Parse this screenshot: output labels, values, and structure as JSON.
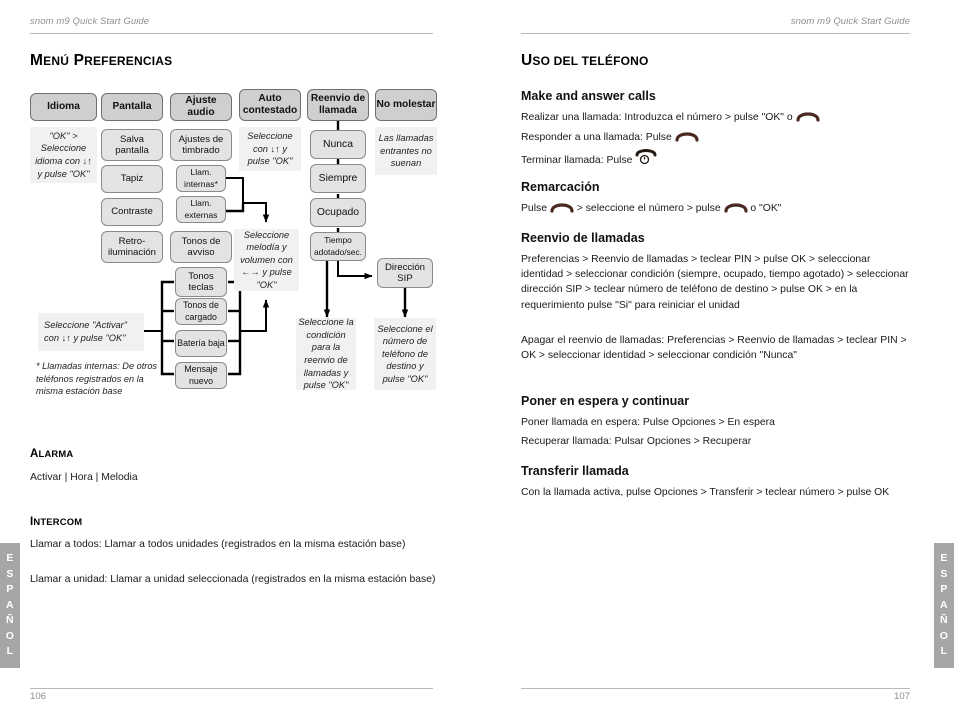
{
  "document": {
    "running_head": "snom m9 Quick Start Guide"
  },
  "left_page": {
    "folio": "106",
    "side_tab": "ESPAÑOL",
    "title_first": "M",
    "title_rest": "ENÚ ",
    "title_second": "P",
    "title_rest2": "REFERENCIAS",
    "title_full": "MENÚ PREFERENCIAS",
    "chart": {
      "columns": [
        {
          "header": "Idioma",
          "note": "\"OK\" > Seleccione idioma con ↓↑ y pulse \"OK\"",
          "items": []
        },
        {
          "header": "Pantalla",
          "items": [
            "Salva pantalla",
            "Tapiz",
            "Contraste",
            "Retro-iluminación"
          ]
        },
        {
          "header": "Ajuste audio",
          "items": [
            "Ajustes de timbrado",
            "Llam. internas*",
            "Llam. externas",
            "Tonos de avviso",
            "Tonos teclas",
            "Tonos de cargado",
            "Batería baja",
            "Mensaje nuevo"
          ]
        },
        {
          "header": "Auto contestado",
          "note": "Seleccione con ↓↑ y pulse \"OK\"",
          "items": []
        },
        {
          "header": "Reenvio de llamada",
          "items": [
            "Nunca",
            "Siempre",
            "Ocupado",
            "Tiempo adotado/sec.",
            "Dirección SIP"
          ]
        },
        {
          "header": "No molestar",
          "note": "Las llamadas entrantes no suenan",
          "items": []
        }
      ],
      "box_idioma": "Idioma",
      "box_pantalla": "Pantalla",
      "box_ajuste_audio": "Ajuste audio",
      "box_auto_contestado": "Auto contestado",
      "box_reenvio_llamada": "Reenvio de llamada",
      "box_no_molestar": "No molestar",
      "box_salva_pantalla": "Salva pantalla",
      "box_tapiz": "Tapiz",
      "box_contraste": "Contraste",
      "box_retroiluminacion": "Retro-iluminación",
      "box_ajustes_timbrado": "Ajustes de timbrado",
      "box_llam_internas": "Llam. internas*",
      "box_llam_externas": "Llam. externas",
      "box_tonos_avviso": "Tonos de avviso",
      "box_tonos_teclas": "Tonos teclas",
      "box_tonos_cargado": "Tonos de cargado",
      "box_bateria_baja": "Batería baja",
      "box_mensaje_nuevo": "Mensaje nuevo",
      "box_nunca": "Nunca",
      "box_siempre": "Siempre",
      "box_ocupado": "Ocupado",
      "box_tiempo": "Tiempo adotado/sec.",
      "box_direccion_sip": "Dirección SIP",
      "note_idioma": "\"OK\" > Seleccione idioma con ↓↑ y pulse \"OK\"",
      "note_auto_contestado": "Seleccione con ↓↑ y pulse \"OK\"",
      "note_no_molestar": "Las llamadas entrantes no suenan",
      "note_melodia": "Seleccione melodía y volumen con ←→ y pulse \"OK\"",
      "note_activar": "Seleccione \"Activar\" con ↓↑  y pulse \"OK\"",
      "note_condicion": "Seleccione la condición para la reenvio de llamadas y pulse \"OK\"",
      "note_numero": "Seleccione el número de teléfono de destino y pulse \"OK\"",
      "footnote": "* Llamadas internas: De otros teléfonos registrados en la misma estación base"
    },
    "sections": [
      {
        "heading_cap": "A",
        "heading_rest": "LARMA",
        "heading": "ALARMA",
        "body": "Activar | Hora | Melodia"
      },
      {
        "heading_cap": "I",
        "heading_rest": "NTERCOM",
        "heading": "INTERCOM",
        "body_1": "Llamar a todos:  Llamar a todos unidades (registrados en la misma estación base)",
        "body_2": "Llamar a unidad:  Llamar a unidad seleccionada (registrados en la misma estación base)"
      }
    ]
  },
  "right_page": {
    "folio": "107",
    "side_tab": "ESPAÑOL",
    "title_cap": "U",
    "title_rest": "SO DEL TELÉFONO",
    "title_full": "USO DEL TELÉFONO",
    "sections": [
      {
        "heading": "Make and answer calls",
        "lines": [
          {
            "pre": "Realizar una llamada: Introduzca el número > pulse \"OK\" o ",
            "icon": "handset-icon",
            "post": ""
          },
          {
            "pre": "Responder a una llamada: Pulse ",
            "icon": "handset-icon",
            "post": ""
          },
          {
            "pre": "Terminar llamada: Pulse ",
            "icon": "end-call-icon",
            "post": ""
          }
        ]
      },
      {
        "heading": "Remarcación",
        "lines": [
          {
            "pre": "Pulse ",
            "icon": "handset-icon",
            "mid": " >  seleccione el número   > pulse ",
            "icon2": "handset-icon",
            "post": " o \"OK\""
          }
        ]
      },
      {
        "heading": "Reenvio de llamadas",
        "paragraph_1": "Preferencias > Reenvio de llamadas  > teclear PIN >  pulse OK  > seleccionar identidad  > seleccionar condición (siempre, ocupado, tiempo agotado) > seleccionar dirección SIP > teclear número de teléfono de destino > pulse OK > en la requerimiento pulse \"Si\" para reiniciar el unidad",
        "paragraph_2": "Apagar el reenvio de llamadas: Preferencias > Reenvio de llamadas >  teclear PIN > OK > seleccionar identidad  > seleccionar condición \"Nunca\""
      },
      {
        "heading": "Poner en espera y continuar",
        "paragraph_1": "Poner llamada en espera: Pulse Opciones > En espera",
        "paragraph_2": "Recuperar llamada: Pulsar Opciones > Recuperar"
      },
      {
        "heading": "Transferir llamada",
        "paragraph_1": "Con la llamada activa, pulse Opciones > Transferir > teclear número > pulse OK"
      }
    ]
  },
  "colors": {
    "node_fill": "#e3e3e3",
    "node_header_fill": "#cfcfcf",
    "note_fill": "#f1f1f1",
    "side_tab": "#a6a6a6",
    "rule": "#b9b9b9",
    "muted_text": "#8e8e8e",
    "icon": "#4a2a20"
  }
}
